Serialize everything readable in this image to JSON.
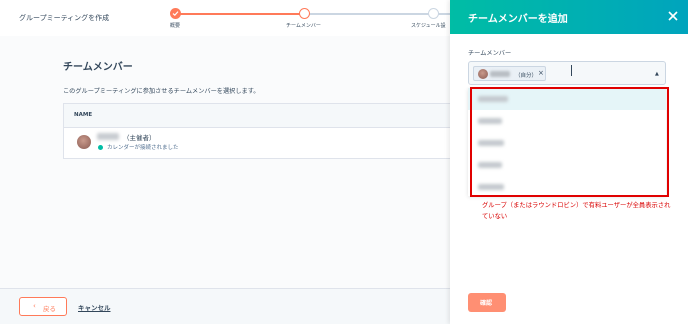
{
  "header": {
    "app_title": "グループミーティングを作成",
    "steps": [
      {
        "label": "概要"
      },
      {
        "label": "チームメンバー"
      },
      {
        "label": "スケジュール設"
      }
    ]
  },
  "main": {
    "section_title": "チームメンバー",
    "description": "このグループミーティングに参加させるチームメンバーを選択します。",
    "table": {
      "column_header": "NAME",
      "rows": [
        {
          "role": "（主催者）",
          "calendar_status": "カレンダーが接続されました"
        }
      ]
    }
  },
  "footer": {
    "back_label": "戻る",
    "back_icon": "chevron-left-icon",
    "cancel_label": "キャンセル"
  },
  "panel": {
    "title": "チームメンバーを追加",
    "close_icon": "close-icon",
    "field_label": "チームメンバー",
    "chip_self": "（自分）",
    "chip_remove": "×",
    "dropdown_arrow": "▲"
  },
  "annotation": {
    "note": "グループ（またはラウンドロビン）で有料ユーザーが全員表示されていない",
    "color": "#e00000"
  },
  "confirm_label": "確認",
  "colors": {
    "accent": "#ff7a59",
    "panel_header": "#00bda5",
    "calendar_dot": "#00bda5"
  }
}
